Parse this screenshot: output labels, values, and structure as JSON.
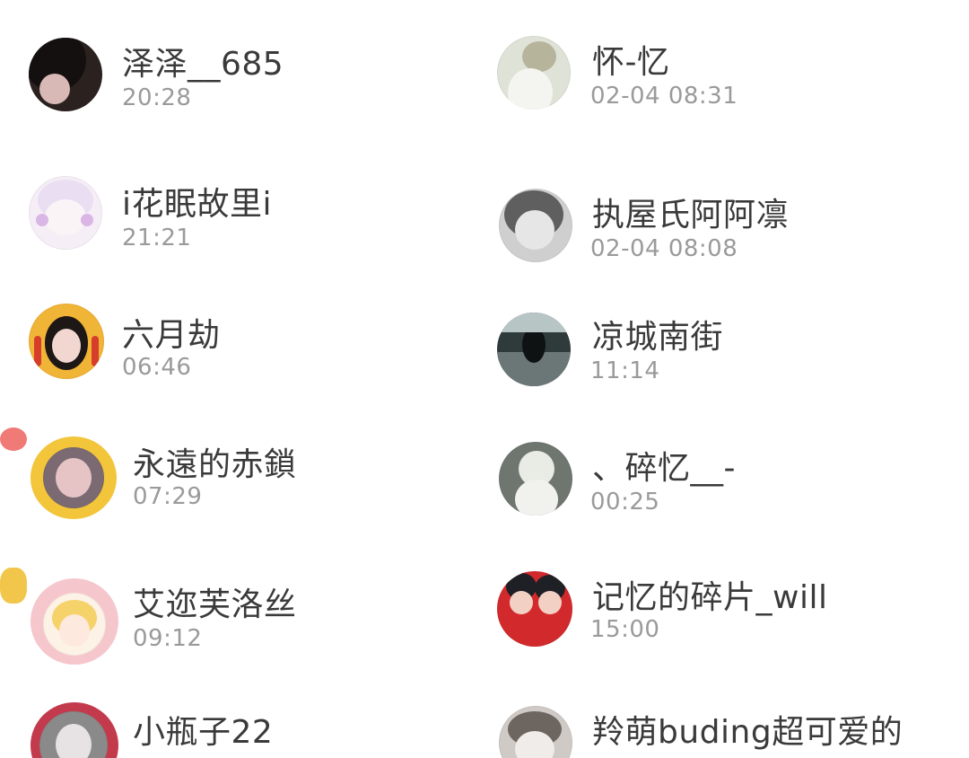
{
  "users": [
    {
      "name": "泽泽__685",
      "time": "20:28",
      "avatar": "avatar-dark-portrait",
      "bg": "#2b2220",
      "accent": "#d8b9b6"
    },
    {
      "name": "怀-忆",
      "time": "02-04 08:31",
      "avatar": "avatar-sketch-girl",
      "bg": "#dfe2d7",
      "accent": "#9ea18f"
    },
    {
      "name": "i花眠故里i",
      "time": "21:21",
      "avatar": "avatar-pastel-anime",
      "bg": "#f5eef6",
      "accent": "#d9b6e6"
    },
    {
      "name": "执屋氏阿阿凛",
      "time": "02-04 08:08",
      "avatar": "avatar-grey-anime",
      "bg": "#cfcfcf",
      "accent": "#5f5f5f"
    },
    {
      "name": "六月劫",
      "time": "06:46",
      "avatar": "avatar-dog-frame-girl",
      "bg": "#f0b436",
      "accent": "#d63d2a"
    },
    {
      "name": "凉城南街",
      "time": "11:14",
      "avatar": "avatar-sea-silhouette",
      "bg": "#2f3a3b",
      "accent": "#b7c5c4"
    },
    {
      "name": "永遠的赤鎖",
      "time": "07:29",
      "avatar": "avatar-pig-frame",
      "bg": "#f2c53a",
      "accent": "#7b6a72"
    },
    {
      "name": "、碎忆__-",
      "time": "00:25",
      "avatar": "avatar-cat-dark",
      "bg": "#6f766f",
      "accent": "#e9ece4"
    },
    {
      "name": "艾迩芙洛丝",
      "time": "09:12",
      "avatar": "avatar-cat-frame-girl",
      "bg": "#f6c6cd",
      "accent": "#f1c64b"
    },
    {
      "name": "记忆的碎片_will",
      "time": "15:00",
      "avatar": "avatar-red-duo",
      "bg": "#d22a2c",
      "accent": "#1f1f26"
    },
    {
      "name": "小瓶子22",
      "time": "",
      "avatar": "avatar-red-frame",
      "bg": "#8a8a8a",
      "accent": "#c23a4c"
    },
    {
      "name": "羚萌buding超可爱的",
      "time": "",
      "avatar": "avatar-sketch-cat",
      "bg": "#cfcac6",
      "accent": "#6d6560"
    }
  ]
}
